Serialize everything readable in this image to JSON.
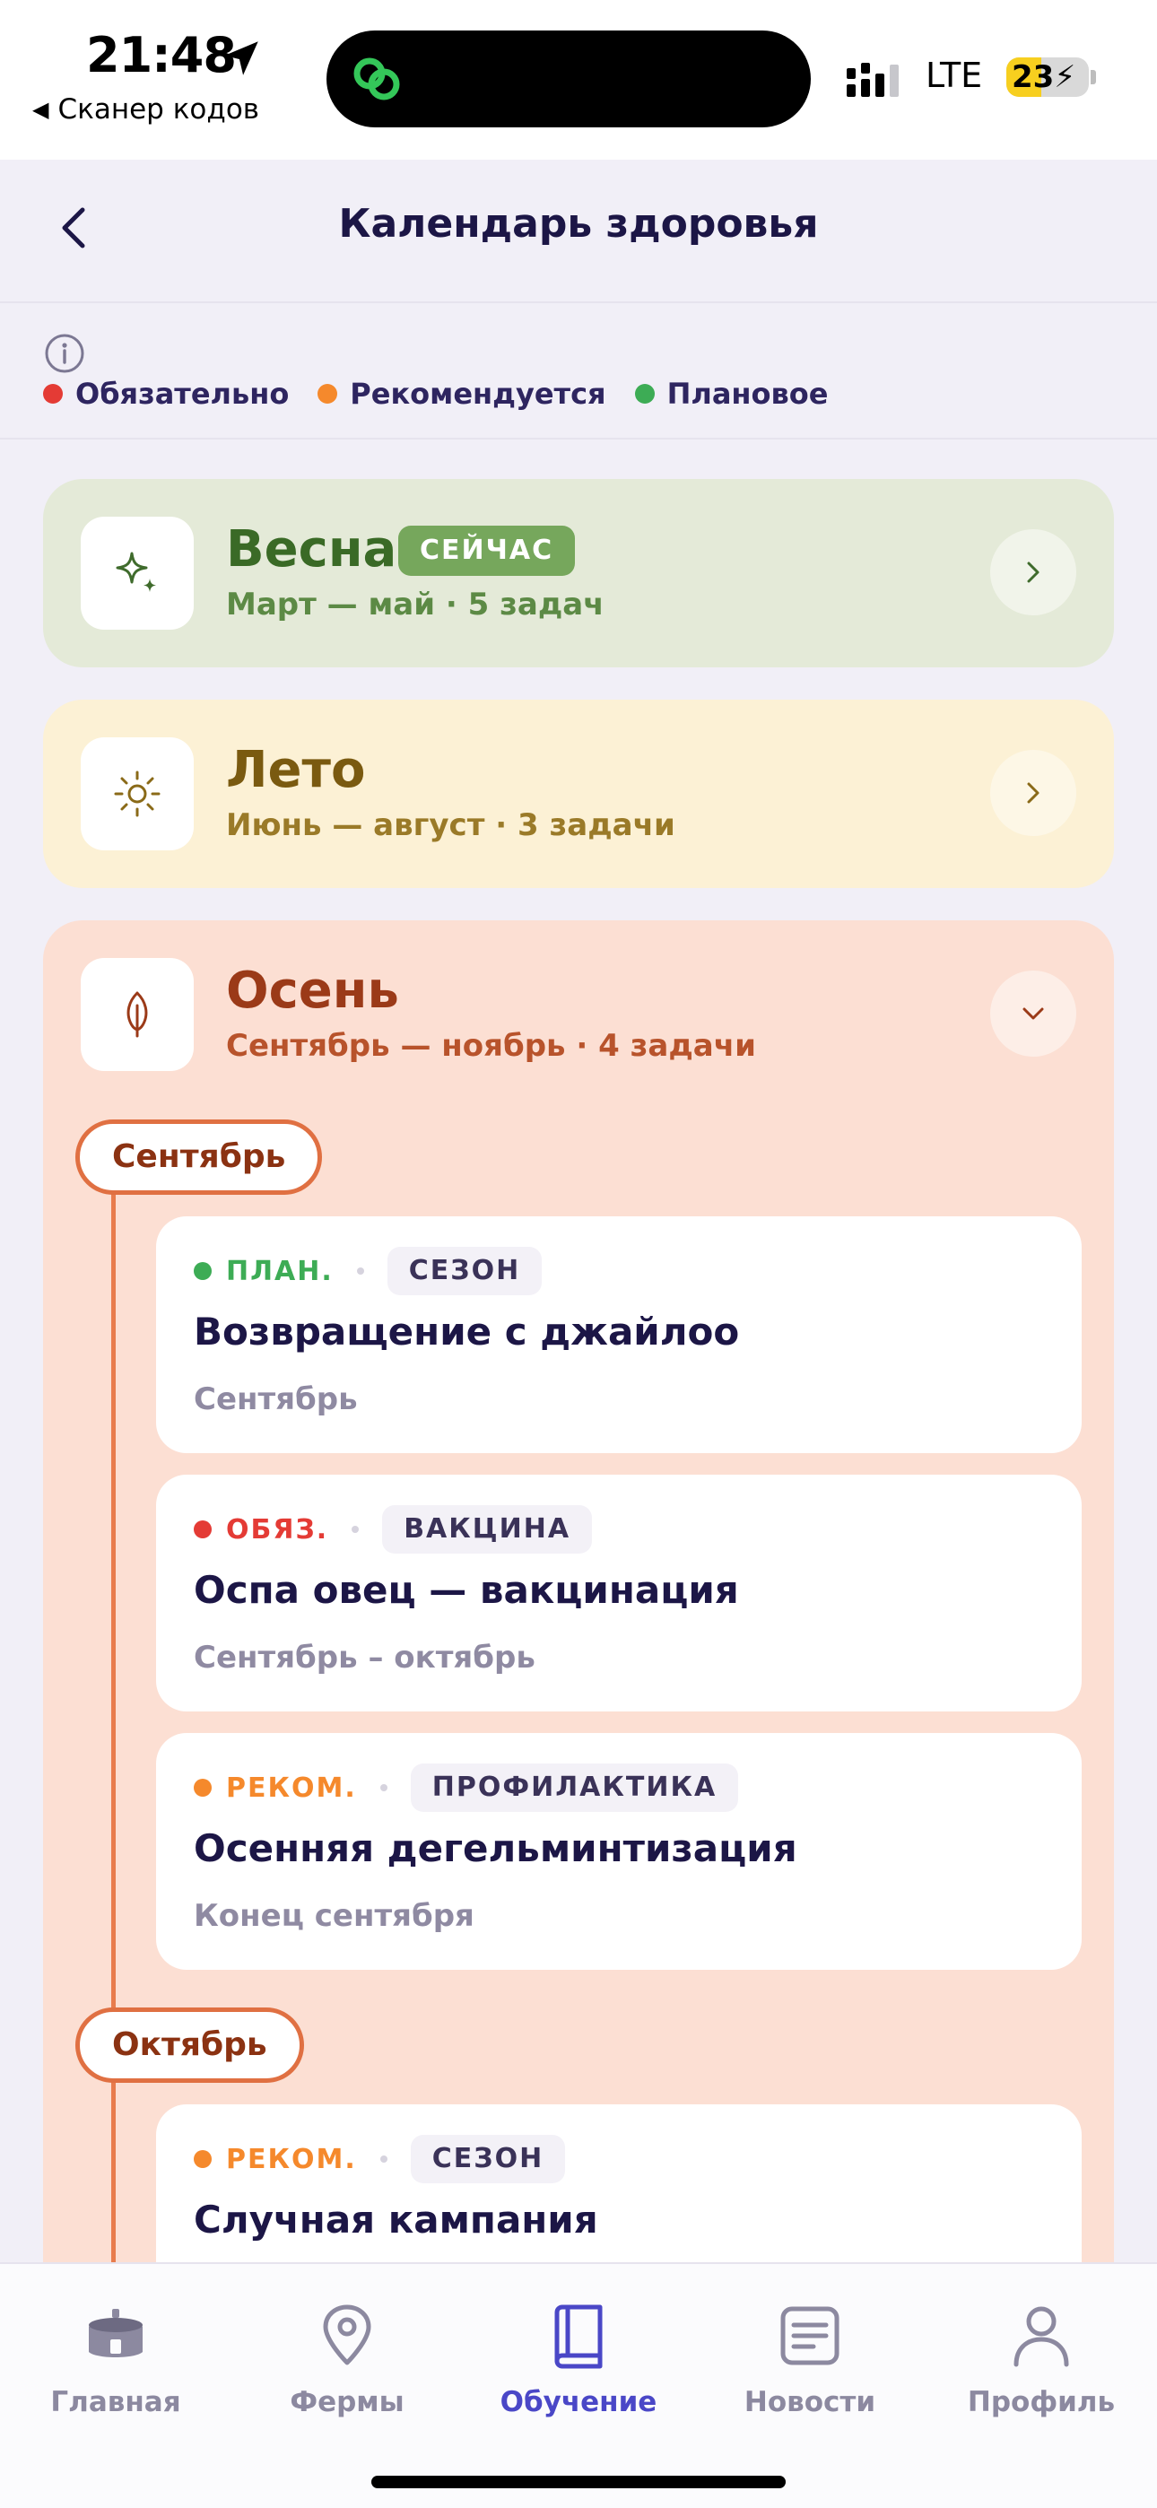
{
  "status_bar": {
    "time": "21:48",
    "back_app": "Сканер кодов",
    "network": "LTE",
    "battery": "23",
    "battery_level": 0.23
  },
  "header": {
    "title": "Календарь здоровья"
  },
  "legend": {
    "items": [
      {
        "label": "Обязательно",
        "color": "#e43b35"
      },
      {
        "label": "Рекомендуется",
        "color": "#f5892c"
      },
      {
        "label": "Плановое",
        "color": "#3dac55"
      }
    ]
  },
  "seasons": [
    {
      "title": "Весна",
      "badge": "СЕЙЧАС",
      "subtitle": "Март — май · 5 задач",
      "expanded": false,
      "icon": "sparkle-icon"
    },
    {
      "title": "Лето",
      "subtitle": "Июнь — август · 3 задачи",
      "expanded": false,
      "icon": "sun-icon"
    },
    {
      "title": "Осень",
      "subtitle": "Сентябрь — ноябрь · 4 задачи",
      "expanded": true,
      "icon": "leaf-icon"
    }
  ],
  "autumn": {
    "months": [
      {
        "name": "Сентябрь",
        "tasks": [
          {
            "priority": "ПЛАН.",
            "priority_color": "#3dac55",
            "type": "СЕЗОН",
            "title": "Возвращение с джайлоо",
            "date": "Сентябрь"
          },
          {
            "priority": "ОБЯЗ.",
            "priority_color": "#e43b35",
            "type": "ВАКЦИНА",
            "title": "Оспа овец — вакцинация",
            "date": "Сентябрь – октябрь"
          },
          {
            "priority": "РЕКОМ.",
            "priority_color": "#f5892c",
            "type": "ПРОФИЛАКТИКА",
            "title": "Осенняя дегельминтизация",
            "date": "Конец сентября"
          }
        ]
      },
      {
        "name": "Октябрь",
        "tasks": [
          {
            "priority": "РЕКОМ.",
            "priority_color": "#f5892c",
            "type": "СЕЗОН",
            "title": "Случная кампания",
            "date": ""
          }
        ]
      }
    ]
  },
  "tabbar": {
    "items": [
      {
        "label": "Главная",
        "icon": "yurt-icon",
        "active": false
      },
      {
        "label": "Фермы",
        "icon": "map-pin-icon",
        "active": false
      },
      {
        "label": "Обучение",
        "icon": "book-icon",
        "active": true
      },
      {
        "label": "Новости",
        "icon": "news-icon",
        "active": false
      },
      {
        "label": "Профиль",
        "icon": "person-icon",
        "active": false
      }
    ]
  }
}
